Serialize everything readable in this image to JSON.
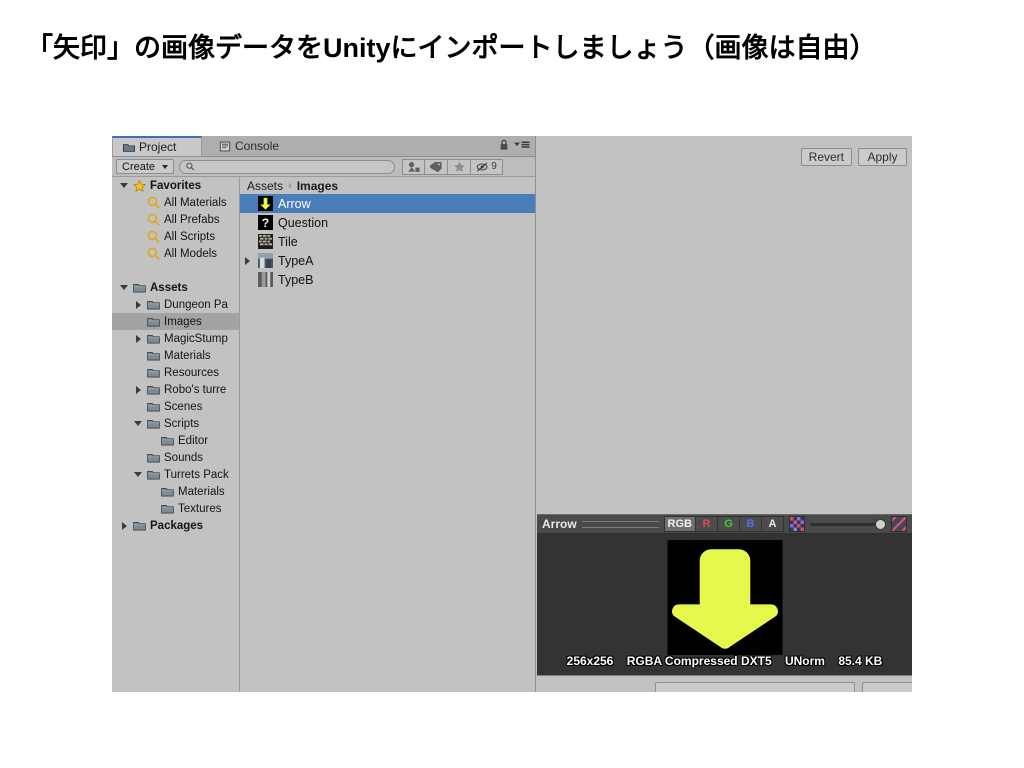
{
  "slide": {
    "title": "「矢印」の画像データをUnityにインポートしましょう（画像は自由）"
  },
  "colors": {
    "arrow_yellow": "#e6f74d",
    "selection_blue": "#4a7ebb",
    "panel_gray": "#c2c2c2",
    "preview_dark": "#333333",
    "tag_blue": "#3d6ec0"
  },
  "project_window": {
    "tabs": [
      {
        "label": "Project",
        "icon": "folder-icon",
        "active": true
      },
      {
        "label": "Console",
        "icon": "console-icon",
        "active": false
      }
    ],
    "header_icons": [
      {
        "name": "lock-icon"
      },
      {
        "name": "panel-menu-icon"
      }
    ],
    "toolbar": {
      "create_label": "Create",
      "search_value": "",
      "search_placeholder": "",
      "icons": [
        {
          "name": "filter-by-type-icon",
          "label": ""
        },
        {
          "name": "filter-by-label-icon",
          "label": ""
        },
        {
          "name": "favorite-star-icon",
          "label": ""
        },
        {
          "name": "hidden-packages-icon",
          "label": "9"
        }
      ]
    },
    "tree": [
      {
        "label": "Favorites",
        "indent": 0,
        "icon": "star-icon",
        "twisty": "open",
        "bold": true,
        "selected": false
      },
      {
        "label": "All Materials",
        "indent": 1,
        "icon": "search-icon",
        "twisty": "none",
        "bold": false,
        "selected": false
      },
      {
        "label": "All Prefabs",
        "indent": 1,
        "icon": "search-icon",
        "twisty": "none",
        "bold": false,
        "selected": false
      },
      {
        "label": "All Scripts",
        "indent": 1,
        "icon": "search-icon",
        "twisty": "none",
        "bold": false,
        "selected": false
      },
      {
        "label": "All Models",
        "indent": 1,
        "icon": "search-icon",
        "twisty": "none",
        "bold": false,
        "selected": false
      },
      {
        "label": "",
        "indent": 0,
        "icon": "none",
        "twisty": "none",
        "bold": false,
        "selected": false
      },
      {
        "label": "Assets",
        "indent": 0,
        "icon": "folder-icon",
        "twisty": "open",
        "bold": true,
        "selected": false
      },
      {
        "label": "Dungeon Pa",
        "indent": 1,
        "icon": "folder-icon",
        "twisty": "closed",
        "bold": false,
        "selected": false
      },
      {
        "label": "Images",
        "indent": 1,
        "icon": "folder-icon",
        "twisty": "none",
        "bold": false,
        "selected": true
      },
      {
        "label": "MagicStump",
        "indent": 1,
        "icon": "folder-icon",
        "twisty": "closed",
        "bold": false,
        "selected": false
      },
      {
        "label": "Materials",
        "indent": 1,
        "icon": "folder-icon",
        "twisty": "none",
        "bold": false,
        "selected": false
      },
      {
        "label": "Resources",
        "indent": 1,
        "icon": "folder-icon",
        "twisty": "none",
        "bold": false,
        "selected": false
      },
      {
        "label": "Robo's turre",
        "indent": 1,
        "icon": "folder-icon",
        "twisty": "closed",
        "bold": false,
        "selected": false
      },
      {
        "label": "Scenes",
        "indent": 1,
        "icon": "folder-icon",
        "twisty": "none",
        "bold": false,
        "selected": false
      },
      {
        "label": "Scripts",
        "indent": 1,
        "icon": "folder-icon",
        "twisty": "open",
        "bold": false,
        "selected": false
      },
      {
        "label": "Editor",
        "indent": 2,
        "icon": "folder-icon",
        "twisty": "none",
        "bold": false,
        "selected": false
      },
      {
        "label": "Sounds",
        "indent": 1,
        "icon": "folder-icon",
        "twisty": "none",
        "bold": false,
        "selected": false
      },
      {
        "label": "Turrets Pack",
        "indent": 1,
        "icon": "folder-icon",
        "twisty": "open",
        "bold": false,
        "selected": false
      },
      {
        "label": "Materials",
        "indent": 2,
        "icon": "folder-icon",
        "twisty": "none",
        "bold": false,
        "selected": false
      },
      {
        "label": "Textures",
        "indent": 2,
        "icon": "folder-icon",
        "twisty": "none",
        "bold": false,
        "selected": false
      },
      {
        "label": "Packages",
        "indent": 0,
        "icon": "folder-icon",
        "twisty": "closed",
        "bold": true,
        "selected": false
      }
    ],
    "breadcrumb": {
      "root": "Assets",
      "separator": "›",
      "current": "Images"
    },
    "assets": [
      {
        "label": "Arrow",
        "thumb": "arrow-thumb",
        "selected": true,
        "expandable": false
      },
      {
        "label": "Question",
        "thumb": "question-thumb",
        "selected": false,
        "expandable": false
      },
      {
        "label": "Tile",
        "thumb": "tile-thumb",
        "selected": false,
        "expandable": false
      },
      {
        "label": "TypeA",
        "thumb": "typea-thumb",
        "selected": false,
        "expandable": true
      },
      {
        "label": "TypeB",
        "thumb": "typeb-thumb",
        "selected": false,
        "expandable": false
      }
    ]
  },
  "inspector": {
    "revert_label": "Revert",
    "apply_label": "Apply",
    "preview": {
      "asset_name": "Arrow",
      "channels": [
        {
          "label": "RGB",
          "active": true,
          "tint": "rgb"
        },
        {
          "label": "R",
          "active": false,
          "tint": "r"
        },
        {
          "label": "G",
          "active": false,
          "tint": "g"
        },
        {
          "label": "B",
          "active": false,
          "tint": "b"
        },
        {
          "label": "A",
          "active": false,
          "tint": "a"
        }
      ],
      "swatch_icon": "color-swatch-icon",
      "mip_slider_value": 100,
      "alpha_checker_icon": "alpha-checker-icon",
      "texture_info": {
        "size": "256x256",
        "format": "RGBA Compressed DXT5",
        "colorspace": "UNorm",
        "filesize": "85.4 KB"
      },
      "tag_icon": "asset-tag-icon"
    }
  }
}
